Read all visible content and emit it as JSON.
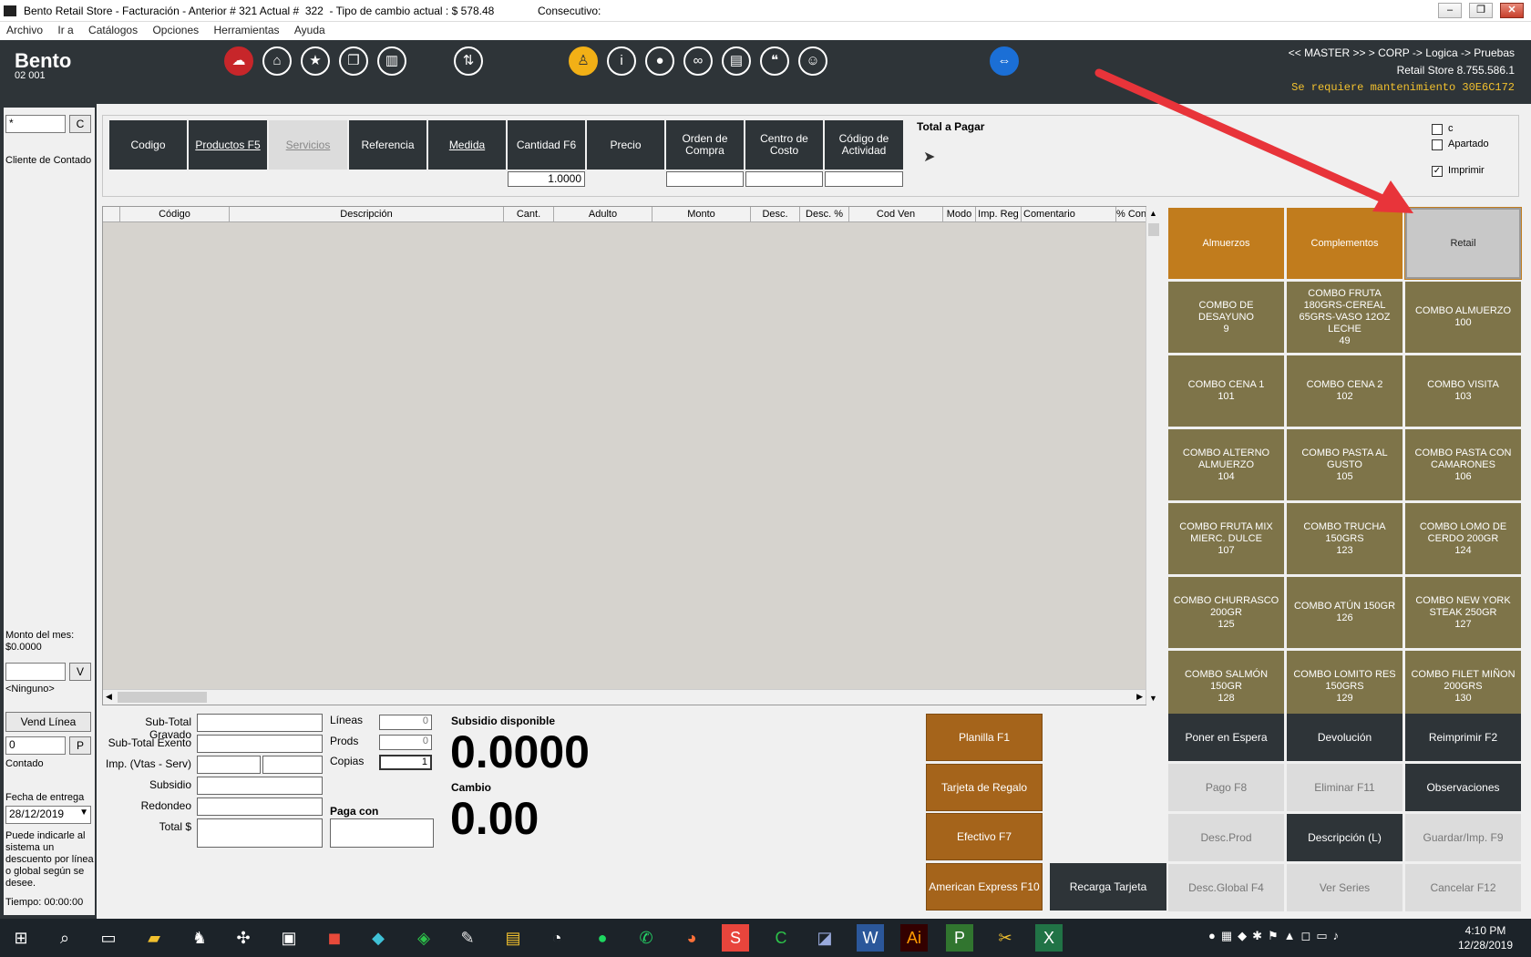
{
  "window": {
    "title": "Bento Retail Store - Facturación - Anterior # 321 Actual #  322  - Tipo de cambio actual : $ 578.48",
    "consecutivo": "Consecutivo:",
    "minimize": "‒",
    "restore": "❐",
    "close": "✕"
  },
  "menu": [
    "Archivo",
    "Ir a",
    "Catálogos",
    "Opciones",
    "Herramientas",
    "Ayuda"
  ],
  "header": {
    "brand": "Bento",
    "branch": "02 001",
    "user_path": "<< MASTER >> > CORP -> Logica -> Pruebas",
    "store": "Retail Store 8.755.586.1",
    "maintenance": "Se requiere mantenimiento 30E6C172",
    "icons": [
      "cloud-icon",
      "home-icon",
      "star-icon",
      "copy-icon",
      "book-icon",
      "transfer-icon",
      "badge-icon",
      "info-icon",
      "bulb-icon",
      "chat-icon",
      "card-icon",
      "quote-icon",
      "support-icon",
      "teamviewer-icon"
    ]
  },
  "sidebar": {
    "search_value": "*",
    "search_btn": "C",
    "cliente": "Cliente de Contado",
    "monto_label": "Monto del mes:",
    "monto_value": "$0.0000",
    "vend_btn": "V",
    "vend_value": "<Ninguno>",
    "vend_linea": "Vend Línea",
    "pago_value": "0",
    "pago_btn": "P",
    "pago_label": "Contado",
    "fecha_label": "Fecha de entrega",
    "fecha_value": "28/12/2019",
    "hint": "Puede indicarle al sistema un descuento por línea o global según se desee.",
    "tiempo": "Tiempo: 00:00:00"
  },
  "columns": {
    "buttons": [
      "Codigo",
      "Productos F5",
      "Servicios",
      "Referencia",
      "Medida",
      "Cantidad F6",
      "Precio",
      "Orden de Compra",
      "Centro de Costo",
      "Código de Actividad"
    ],
    "cantidad_value": "1.0000",
    "total_pagar": "Total a Pagar",
    "check_c": "c",
    "check_apartado": "Apartado",
    "check_imprimir": "Imprimir"
  },
  "grid": {
    "headers": [
      "",
      "Código",
      "Descripción",
      "Cant.",
      "Adulto",
      "Monto",
      "Desc.",
      "Desc. %",
      "Cod Ven",
      "Modo",
      "Imp. Reg",
      "Comentario",
      "% Con"
    ]
  },
  "categories": [
    "Almuerzos",
    "Complementos",
    "Retail"
  ],
  "products": [
    {
      "name": "COMBO DE DESAYUNO",
      "code": "9"
    },
    {
      "name": "COMBO FRUTA 180GRS-CEREAL 65GRS-VASO 12OZ LECHE",
      "code": "49"
    },
    {
      "name": "COMBO ALMUERZO",
      "code": "100"
    },
    {
      "name": "COMBO CENA 1",
      "code": "101"
    },
    {
      "name": "COMBO CENA 2",
      "code": "102"
    },
    {
      "name": "COMBO VISITA",
      "code": "103"
    },
    {
      "name": "COMBO ALTERNO ALMUERZO",
      "code": "104"
    },
    {
      "name": "COMBO PASTA AL GUSTO",
      "code": "105"
    },
    {
      "name": "COMBO PASTA CON CAMARONES",
      "code": "106"
    },
    {
      "name": "COMBO FRUTA MIX MIERC. DULCE",
      "code": "107"
    },
    {
      "name": "COMBO TRUCHA 150GRS",
      "code": "123"
    },
    {
      "name": "COMBO LOMO DE CERDO 200GR",
      "code": "124"
    },
    {
      "name": "COMBO CHURRASCO 200GR",
      "code": "125"
    },
    {
      "name": "COMBO ATÚN 150GR",
      "code": "126"
    },
    {
      "name": "COMBO NEW YORK STEAK 250GR",
      "code": "127"
    },
    {
      "name": "COMBO SALMÓN 150GR",
      "code": "128"
    },
    {
      "name": "COMBO LOMITO RES 150GRS",
      "code": "129"
    },
    {
      "name": "COMBO FILET MIÑON 200GRS",
      "code": "130"
    }
  ],
  "totals": {
    "subtotal_gravado": "Sub-Total Gravado",
    "subtotal_exento": "Sub-Total Exento",
    "imp": "Imp. (Vtas - Serv)",
    "subsidio": "Subsidio",
    "redondeo": "Redondeo",
    "total": "Total $",
    "lineas_label": "Líneas",
    "lineas_value": "0",
    "prods_label": "Prods",
    "prods_value": "0",
    "copias_label": "Copias",
    "copias_value": "1",
    "paga_con": "Paga con",
    "subsidio_disp_label": "Subsidio disponible",
    "subsidio_disp_value": "0.0000",
    "cambio_label": "Cambio",
    "cambio_value": "0.00"
  },
  "payments": [
    "Planilla F1",
    "Tarjeta de Regalo",
    "Efectivo F7",
    "American Express F10"
  ],
  "recarga": "Recarga Tarjeta",
  "actions": [
    {
      "label": "Poner en Espera",
      "style": "dark"
    },
    {
      "label": "Devolución",
      "style": "dark"
    },
    {
      "label": "Reimprimir F2",
      "style": "dark"
    },
    {
      "label": "Pago F8",
      "style": "light"
    },
    {
      "label": "Eliminar F11",
      "style": "light"
    },
    {
      "label": "Observaciones",
      "style": "dark"
    },
    {
      "label": "Desc.Prod",
      "style": "light"
    },
    {
      "label": "Descripción (L)",
      "style": "dark"
    },
    {
      "label": "Guardar/Imp. F9",
      "style": "light"
    },
    {
      "label": "Desc.Global F4",
      "style": "light"
    },
    {
      "label": "Ver Series",
      "style": "light"
    },
    {
      "label": "Cancelar F12",
      "style": "light"
    }
  ],
  "taskbar": {
    "time": "4:10 PM",
    "date": "12/28/2019"
  },
  "colors": {
    "dark": "#2e3438",
    "orange": "#c17c1d",
    "olive": "#7e7449",
    "brown": "#a5641b",
    "arrow": "#e8343a"
  }
}
